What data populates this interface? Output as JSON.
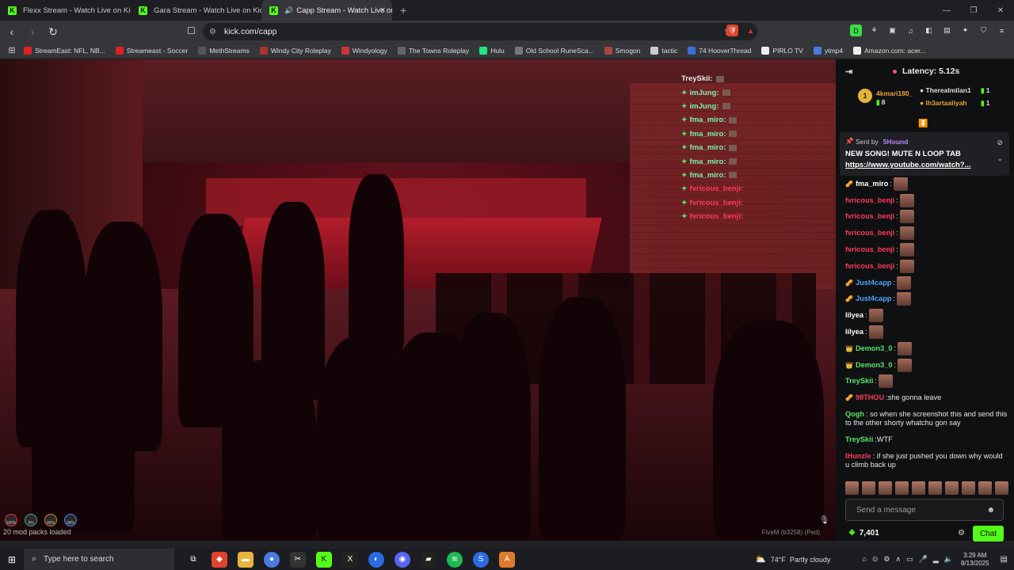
{
  "tabs": [
    {
      "label": "Flexx Stream - Watch Live on Kick",
      "active": false
    },
    {
      "label": "Gara Stream - Watch Live on Kick",
      "active": false
    },
    {
      "label": "Capp Stream - Watch Live on",
      "active": true
    }
  ],
  "address": {
    "url": "kick.com/capp"
  },
  "bookmarks": [
    {
      "label": "StreamEast: NFL, NB...",
      "color": "#d22"
    },
    {
      "label": "Streameast - Soccer",
      "color": "#d22"
    },
    {
      "label": "MethStreams",
      "color": "#555"
    },
    {
      "label": "Windy City Roleplay",
      "color": "#a33"
    },
    {
      "label": "Windyology",
      "color": "#c33"
    },
    {
      "label": "The Towns Roleplay",
      "color": "#666"
    },
    {
      "label": "Hulu",
      "color": "#1ce783"
    },
    {
      "label": "Old School RuneSca...",
      "color": "#777"
    },
    {
      "label": "Smogon",
      "color": "#a44"
    },
    {
      "label": "tactic",
      "color": "#ccc"
    },
    {
      "label": "74 HooverThread",
      "color": "#3a6fd8"
    },
    {
      "label": "PIRLO TV",
      "color": "#eee"
    },
    {
      "label": "ytmp4",
      "color": "#4a7be0"
    },
    {
      "label": "Amazon.com: acer...",
      "color": "#eee"
    }
  ],
  "overlay_chat": [
    {
      "user": "TreySkii",
      "cls": "u-first"
    },
    {
      "user": "imJung",
      "cls": ""
    },
    {
      "user": "imJung",
      "cls": ""
    },
    {
      "user": "fma_miro",
      "cls": ""
    },
    {
      "user": "fma_miro",
      "cls": ""
    },
    {
      "user": "fma_miro",
      "cls": ""
    },
    {
      "user": "fma_miro",
      "cls": ""
    },
    {
      "user": "fma_miro",
      "cls": ""
    },
    {
      "user": "fvricous_benji",
      "cls": "u-red"
    },
    {
      "user": "fvricous_benji",
      "cls": "u-red"
    },
    {
      "user": "fvricous_benji",
      "cls": "u-red"
    }
  ],
  "video": {
    "mod_status": "20 mod packs loaded",
    "watermark": "FiveM (b3258) (Ped)"
  },
  "chat": {
    "latency": "Latency: 5.12s",
    "leaderboard": {
      "rank": "1",
      "first_user": "4kmari180_",
      "first_count": "8",
      "second_user": "Therealmilan1",
      "second_count": "1",
      "third_user": "lh3artaaliyah",
      "third_count": "1"
    },
    "pinned": {
      "sent_by": "Sent by",
      "sender": "5Hound",
      "message": "NEW SONG! MUTE N LOOP TAB",
      "link": "https://www.youtube.com/watch?..."
    },
    "messages": [
      {
        "user": "fma_miro",
        "color": "#ffffff",
        "badge": "🥜",
        "text": "",
        "emote": true
      },
      {
        "user": "fvricous_benji",
        "color": "#ff3b5a",
        "badge": "",
        "text": "",
        "emote": true
      },
      {
        "user": "fvricous_benji",
        "color": "#ff3b5a",
        "badge": "",
        "text": "",
        "emote": true
      },
      {
        "user": "fvricous_benji",
        "color": "#ff3b5a",
        "badge": "",
        "text": "",
        "emote": true
      },
      {
        "user": "fvricous_benji",
        "color": "#ff3b5a",
        "badge": "",
        "text": "",
        "emote": true
      },
      {
        "user": "fvricous_benji",
        "color": "#ff3b5a",
        "badge": "",
        "text": "",
        "emote": true
      },
      {
        "user": "Just4capp",
        "color": "#4ea3ff",
        "badge": "🥜",
        "text": "",
        "emote": true
      },
      {
        "user": "Just4capp",
        "color": "#4ea3ff",
        "badge": "🥜",
        "text": "",
        "emote": true
      },
      {
        "user": "lilyea",
        "color": "#ffffff",
        "badge": "",
        "text": "",
        "emote": true
      },
      {
        "user": "lilyea",
        "color": "#ffffff",
        "badge": "",
        "text": "",
        "emote": true
      },
      {
        "user": "Demon3_0",
        "color": "#5be36b",
        "badge": "👑",
        "text": "",
        "emote": true
      },
      {
        "user": "Demon3_0",
        "color": "#5be36b",
        "badge": "👑",
        "text": "",
        "emote": true
      },
      {
        "user": "TreySkii",
        "color": "#5be36b",
        "badge": "",
        "text": "",
        "emote": true
      },
      {
        "user": "98THOU",
        "color": "#ff3b5a",
        "badge": "🥜",
        "text": "she gonna leave",
        "emote": false
      },
      {
        "user": "Qogh",
        "color": "#5be36b",
        "badge": "",
        "text": "so when she screenshot this and send this to the other shorty whatchu gon say",
        "emote": false,
        "wrap": true
      },
      {
        "user": "TreySkii",
        "color": "#5be36b",
        "badge": "",
        "text": "WTF",
        "emote": false
      },
      {
        "user": "lHunzle",
        "color": "#ff3b5a",
        "badge": "",
        "text": "if she just pushed you down why would u climb back up",
        "emote": false,
        "wrap": true
      }
    ],
    "send_placeholder": "Send a message",
    "points": "7,401",
    "chat_button": "Chat"
  },
  "taskbar": {
    "search_placeholder": "Type here to search",
    "weather_temp": "74°F",
    "weather_desc": "Partly cloudy",
    "time": "3:29 AM",
    "date": "8/13/2025"
  }
}
